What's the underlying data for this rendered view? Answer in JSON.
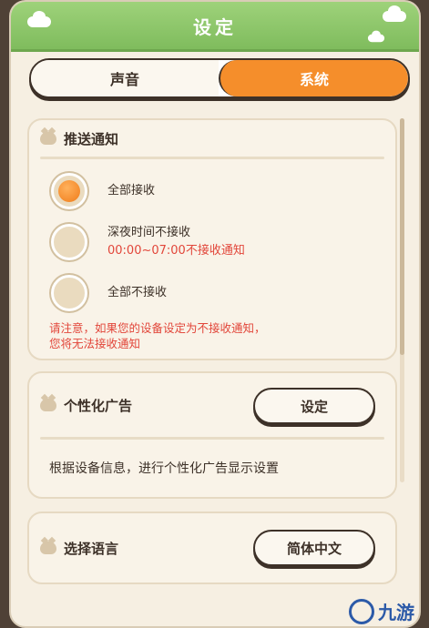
{
  "header": {
    "title": "设定"
  },
  "tabs": [
    {
      "label": "声音",
      "active": false
    },
    {
      "label": "系统",
      "active": true
    }
  ],
  "push": {
    "title": "推送通知",
    "options": [
      {
        "label": "全部接收",
        "sub": "",
        "selected": true
      },
      {
        "label": "深夜时间不接收",
        "sub": "00:00~07:00不接收通知",
        "selected": false
      },
      {
        "label": "全部不接收",
        "sub": "",
        "selected": false
      }
    ],
    "warning_line1": "请注意，如果您的设备设定为不接收通知，",
    "warning_line2": "您将无法接收通知"
  },
  "ads": {
    "title": "个性化广告",
    "button": "设定",
    "description": "根据设备信息，进行个性化广告显示设置"
  },
  "language": {
    "title": "选择语言",
    "button": "简体中文"
  },
  "watermark": {
    "text": "九游"
  },
  "colors": {
    "accent": "#f58e2b",
    "header_green": "#8cc86a",
    "warning": "#e2463a"
  }
}
